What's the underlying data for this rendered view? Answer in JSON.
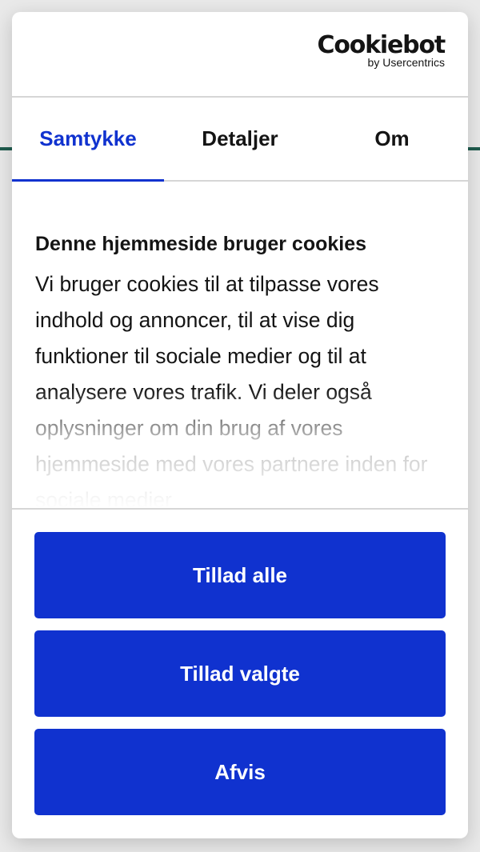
{
  "logo": {
    "name": "Cookiebot",
    "byline": "by Usercentrics"
  },
  "tabs": [
    {
      "label": "Samtykke",
      "active": true
    },
    {
      "label": "Detaljer",
      "active": false
    },
    {
      "label": "Om",
      "active": false
    }
  ],
  "content": {
    "title": "Denne hjemmeside bruger cookies",
    "text": "Vi bruger cookies til at tilpasse vores indhold og annoncer, til at vise dig funktioner til sociale medier og til at analysere vores trafik. Vi deler også oplysninger om din brug af vores hjemmeside med vores partnere inden for sociale medier"
  },
  "buttons": {
    "allow_all": "Tillad alle",
    "allow_selected": "Tillad valgte",
    "reject": "Afvis"
  },
  "colors": {
    "accent": "#1032cf",
    "backdrop_line": "#1f5b4e"
  }
}
